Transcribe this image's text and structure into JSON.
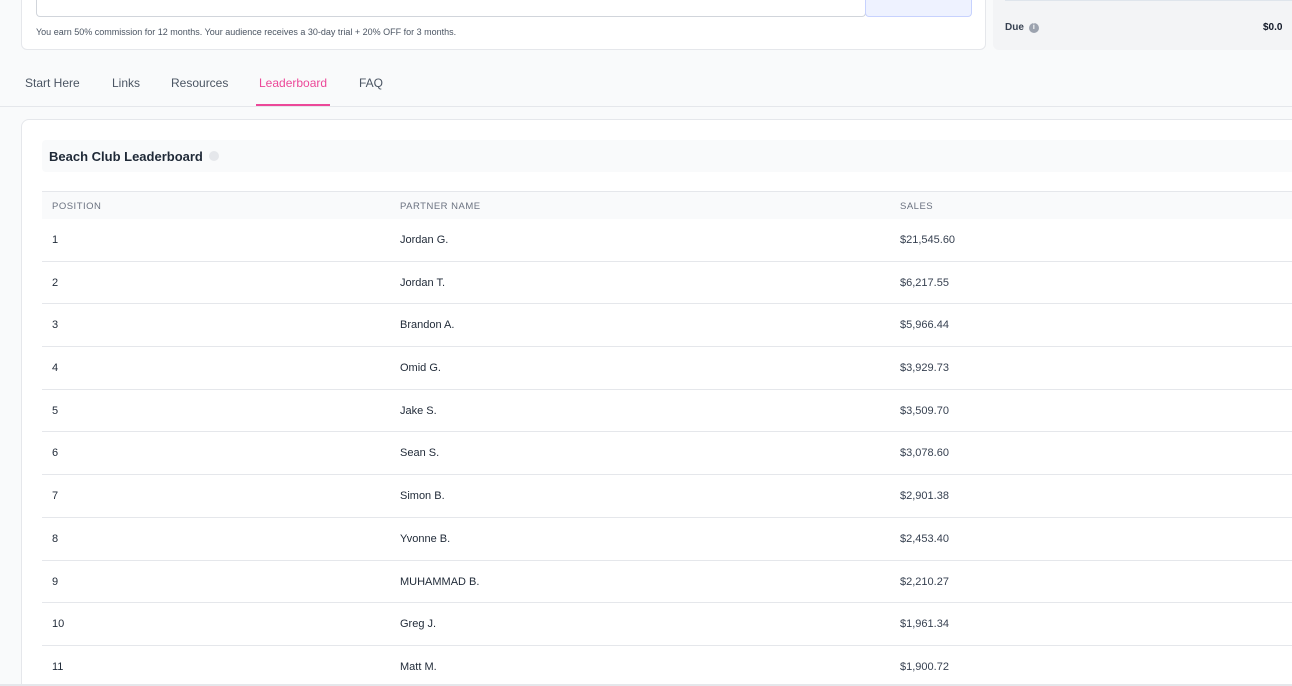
{
  "program": {
    "commission_note": "You earn 50% commission for 12 months. Your audience receives a 30-day trial + 20% OFF for 3 months."
  },
  "balance": {
    "due_label": "Due",
    "due_value": "$0.0"
  },
  "tabs": [
    {
      "label": "Start Here",
      "active": false
    },
    {
      "label": "Links",
      "active": false
    },
    {
      "label": "Resources",
      "active": false
    },
    {
      "label": "Leaderboard",
      "active": true
    },
    {
      "label": "FAQ",
      "active": false
    }
  ],
  "leaderboard": {
    "title": "Beach Club Leaderboard",
    "columns": [
      "POSITION",
      "PARTNER NAME",
      "SALES"
    ],
    "rows": [
      {
        "position": "1",
        "name": "Jordan G.",
        "sales": "$21,545.60"
      },
      {
        "position": "2",
        "name": "Jordan T.",
        "sales": "$6,217.55"
      },
      {
        "position": "3",
        "name": "Brandon A.",
        "sales": "$5,966.44"
      },
      {
        "position": "4",
        "name": "Omid G.",
        "sales": "$3,929.73"
      },
      {
        "position": "5",
        "name": "Jake S.",
        "sales": "$3,509.70"
      },
      {
        "position": "6",
        "name": "Sean S.",
        "sales": "$3,078.60"
      },
      {
        "position": "7",
        "name": "Simon B.",
        "sales": "$2,901.38"
      },
      {
        "position": "8",
        "name": "Yvonne B.",
        "sales": "$2,453.40"
      },
      {
        "position": "9",
        "name": "MUHAMMAD B.",
        "sales": "$2,210.27"
      },
      {
        "position": "10",
        "name": "Greg J.",
        "sales": "$1,961.34"
      },
      {
        "position": "11",
        "name": "Matt M.",
        "sales": "$1,900.72"
      }
    ]
  },
  "colors": {
    "accent": "#ec4899"
  }
}
